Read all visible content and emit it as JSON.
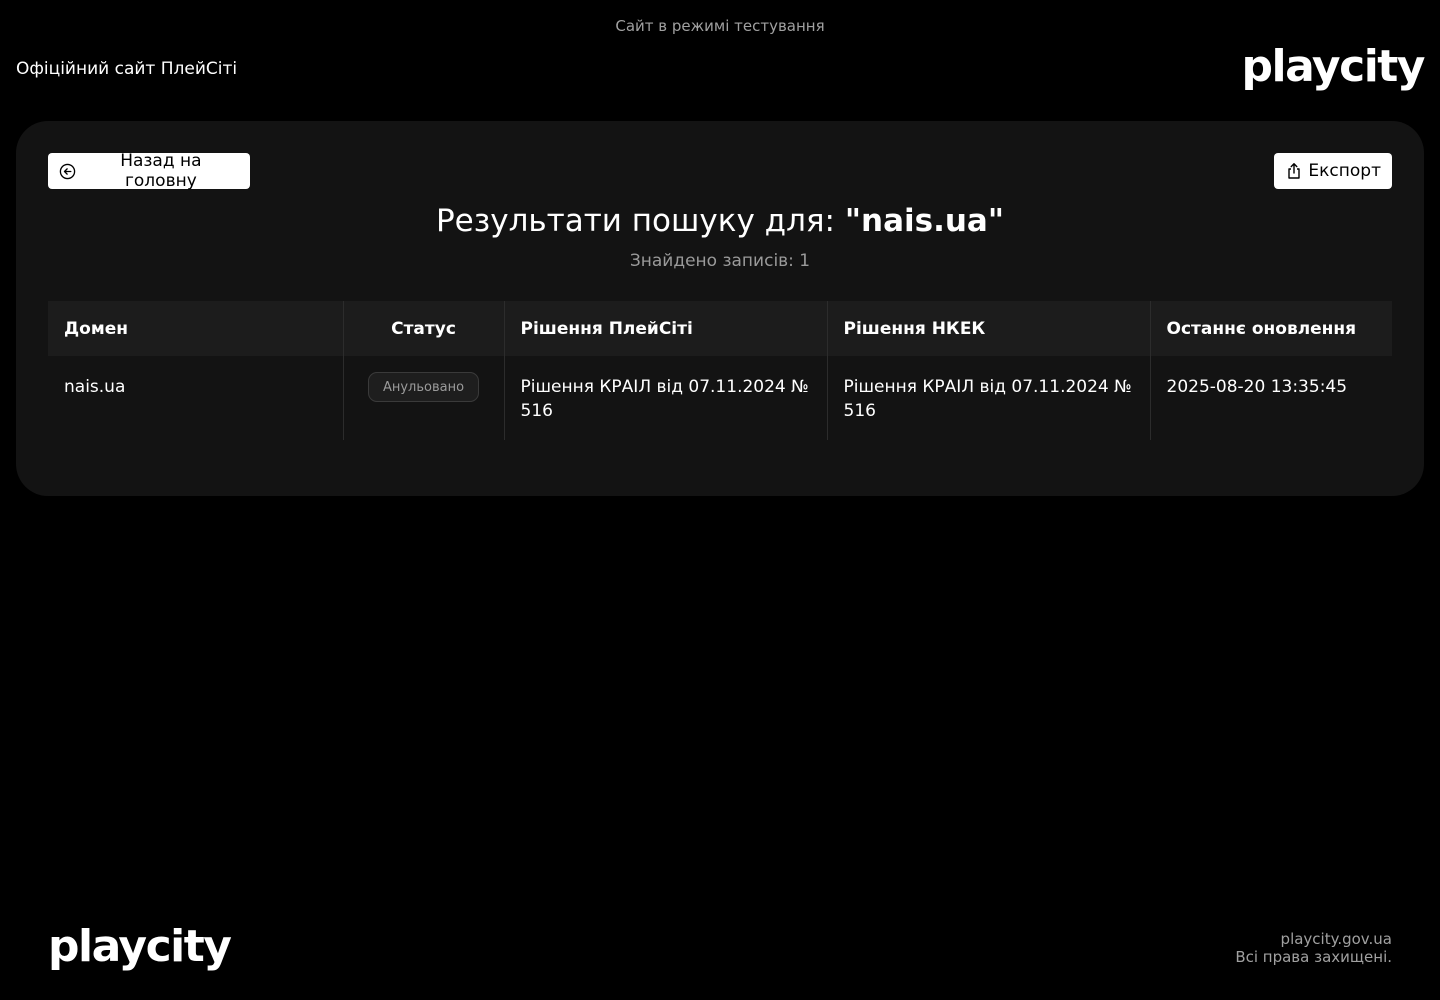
{
  "banner": {
    "text": "Сайт в режимі тестування"
  },
  "header": {
    "site_title": "Офіційний сайт ПлейСіті",
    "logo_text": "playcity"
  },
  "card": {
    "back_button": {
      "label": "Назад на головну",
      "icon": "arrow-left-circle-icon"
    },
    "export_button": {
      "label": "Експорт",
      "icon": "share-upload-icon"
    },
    "title_prefix": "Результати пошуку для:",
    "title_query": "\"nais.ua\"",
    "count_text": "Знайдено записів: 1",
    "table": {
      "headers": [
        "Домен",
        "Статус",
        "Рішення ПлейСіті",
        "Рішення НКЕК",
        "Останнє оновлення"
      ],
      "rows": [
        {
          "domain": "nais.ua",
          "status": "Анульовано",
          "playcity_decision": "Рішення КРАІЛ від 07.11.2024 № 516",
          "nkek_decision": "Рішення КРАІЛ від 07.11.2024 № 516",
          "last_update": "2025-08-20 13:35:45"
        }
      ]
    }
  },
  "footer": {
    "logo_text": "playcity",
    "domain": "playcity.gov.ua",
    "rights": "Всі права захищені."
  },
  "colors": {
    "background": "#000000",
    "card": "#131313",
    "table_header": "#1c1c1c",
    "muted_text": "#9a9a9a",
    "button_bg": "#ffffff"
  }
}
